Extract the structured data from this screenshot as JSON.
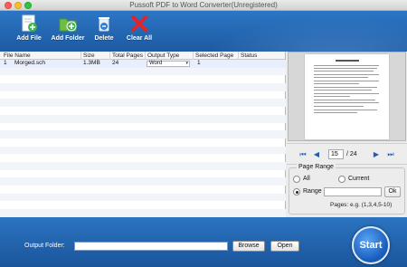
{
  "window": {
    "title": "Pussoft PDF to Word Converter(Unregistered)"
  },
  "toolbar": {
    "add_file": "Add File",
    "add_folder": "Add Folder",
    "delete": "Delete",
    "clear_all": "Clear All"
  },
  "table": {
    "columns": [
      "File Name",
      "Size",
      "Total Pages",
      "Output Type",
      "Selected Page",
      "Status"
    ],
    "rows": [
      {
        "index": "1",
        "name": "Morged.sch",
        "size": "1.3MB",
        "total_pages": "24",
        "output_type": "Word",
        "selected_page": "1",
        "status": ""
      }
    ]
  },
  "preview": {
    "current_page": "15",
    "total_label": "/ 24"
  },
  "page_range": {
    "title": "Page Range",
    "all": "All",
    "current": "Current",
    "range": "Range",
    "ok": "Ok",
    "hint": "Pages: e.g. (1,3,4,5-10)",
    "selected": "range"
  },
  "bottom": {
    "output_folder_label": "Output Folder:",
    "output_folder_value": "",
    "browse": "Browse",
    "open": "Open",
    "start": "Start"
  },
  "colors": {
    "accent": "#1f62b3",
    "toolbar": "#2a72c2"
  }
}
